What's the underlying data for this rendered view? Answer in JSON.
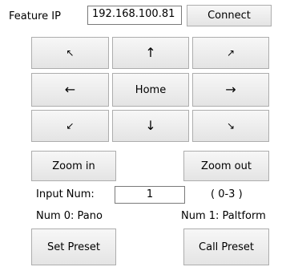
{
  "feature_ip": {
    "label": "Feature IP",
    "value": "192.168.100.81",
    "connect_label": "Connect"
  },
  "ptz": {
    "up_left": "↖",
    "up": "↑",
    "up_right": "↗",
    "left": "←",
    "home": "Home",
    "right": "→",
    "down_left": "↙",
    "down": "↓",
    "down_right": "↘"
  },
  "zoom": {
    "in_label": "Zoom in",
    "out_label": "Zoom out"
  },
  "input_num": {
    "label": "Input Num:",
    "value": "1",
    "range": "( 0-3 )"
  },
  "nums": {
    "num0": "Num 0: Pano",
    "num1": "Num 1: Paltform"
  },
  "preset": {
    "set_label": "Set Preset",
    "call_label": "Call Preset"
  }
}
